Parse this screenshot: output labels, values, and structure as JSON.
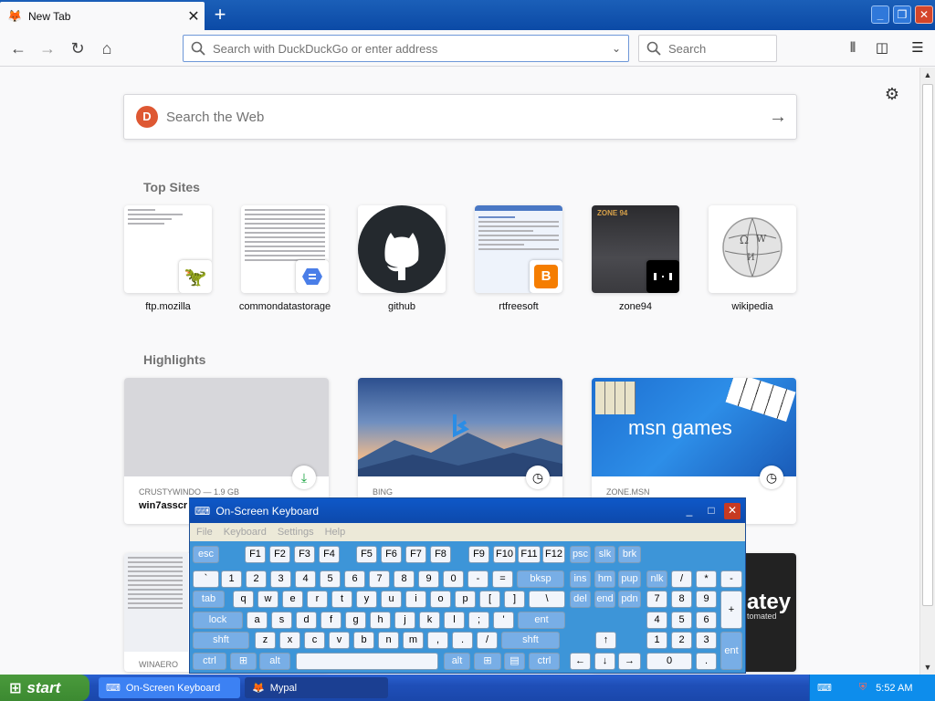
{
  "browser": {
    "tab_title": "New Tab",
    "tab_icon": "fox-icon",
    "new_tab_symbol": "+",
    "url_placeholder": "Search with DuckDuckGo or enter address",
    "search_placeholder": "Search",
    "window_buttons": [
      "minimize",
      "restore",
      "close"
    ]
  },
  "newtab": {
    "web_search_placeholder": "Search the Web",
    "top_sites_title": "Top Sites",
    "top_sites": [
      {
        "label": "ftp.mozilla",
        "badge": "red-dino-icon"
      },
      {
        "label": "commondatastorage",
        "badge": "google-cloud-icon"
      },
      {
        "label": "github",
        "badge": "github-octocat-icon"
      },
      {
        "label": "rtfreesoft",
        "badge": "blogger-icon"
      },
      {
        "label": "zone94",
        "badge": "zone94-icon"
      },
      {
        "label": "wikipedia",
        "badge": "wikipedia-globe-icon"
      }
    ],
    "highlights_title": "Highlights",
    "highlights": [
      {
        "meta": "CRUSTYWINDO — 1.9 GB",
        "title": "win7asscr",
        "action": "download-icon"
      },
      {
        "meta": "BING",
        "title": "",
        "action": "clock-icon"
      },
      {
        "meta": "ZONE.MSN",
        "title": "",
        "action": "clock-icon",
        "image_text": "msn games"
      }
    ],
    "bottom_cards": [
      {
        "meta": "WINAERO"
      },
      {
        "image_text": "atey",
        "image_subtext": "tomated"
      }
    ]
  },
  "osk": {
    "title": "On-Screen Keyboard",
    "menu": [
      "File",
      "Keyboard",
      "Settings",
      "Help"
    ],
    "rows": {
      "r1": [
        "esc",
        "F1",
        "F2",
        "F3",
        "F4",
        "F5",
        "F6",
        "F7",
        "F8",
        "F9",
        "F10",
        "F11",
        "F12",
        "psc",
        "slk",
        "brk"
      ],
      "r2": [
        "`",
        "1",
        "2",
        "3",
        "4",
        "5",
        "6",
        "7",
        "8",
        "9",
        "0",
        "-",
        "=",
        "bksp",
        "ins",
        "hm",
        "pup",
        "nlk",
        "/",
        "*",
        "-"
      ],
      "r3": [
        "tab",
        "q",
        "w",
        "e",
        "r",
        "t",
        "y",
        "u",
        "i",
        "o",
        "p",
        "[",
        "]",
        "\\",
        "del",
        "end",
        "pdn",
        "7",
        "8",
        "9",
        "+"
      ],
      "r4": [
        "lock",
        "a",
        "s",
        "d",
        "f",
        "g",
        "h",
        "j",
        "k",
        "l",
        ";",
        "'",
        "ent",
        "4",
        "5",
        "6"
      ],
      "r5": [
        "shft",
        "z",
        "x",
        "c",
        "v",
        "b",
        "n",
        "m",
        ",",
        ".",
        "/",
        "shft",
        "↑",
        "1",
        "2",
        "3",
        "ent"
      ],
      "r6": [
        "ctrl",
        "win",
        "alt",
        "",
        "alt",
        "win",
        "menu",
        "ctrl",
        "←",
        "↓",
        "→",
        "0",
        "."
      ]
    }
  },
  "taskbar": {
    "start_label": "start",
    "buttons": [
      {
        "label": "On-Screen Keyboard"
      },
      {
        "label": "Mypal"
      }
    ],
    "clock": "5:52 AM"
  },
  "colors": {
    "titlebar_blue": "#0b4aa6",
    "taskbar_blue": "#1f4fb8",
    "start_green": "#3c8a31",
    "osk_blue": "#3d95d8"
  }
}
